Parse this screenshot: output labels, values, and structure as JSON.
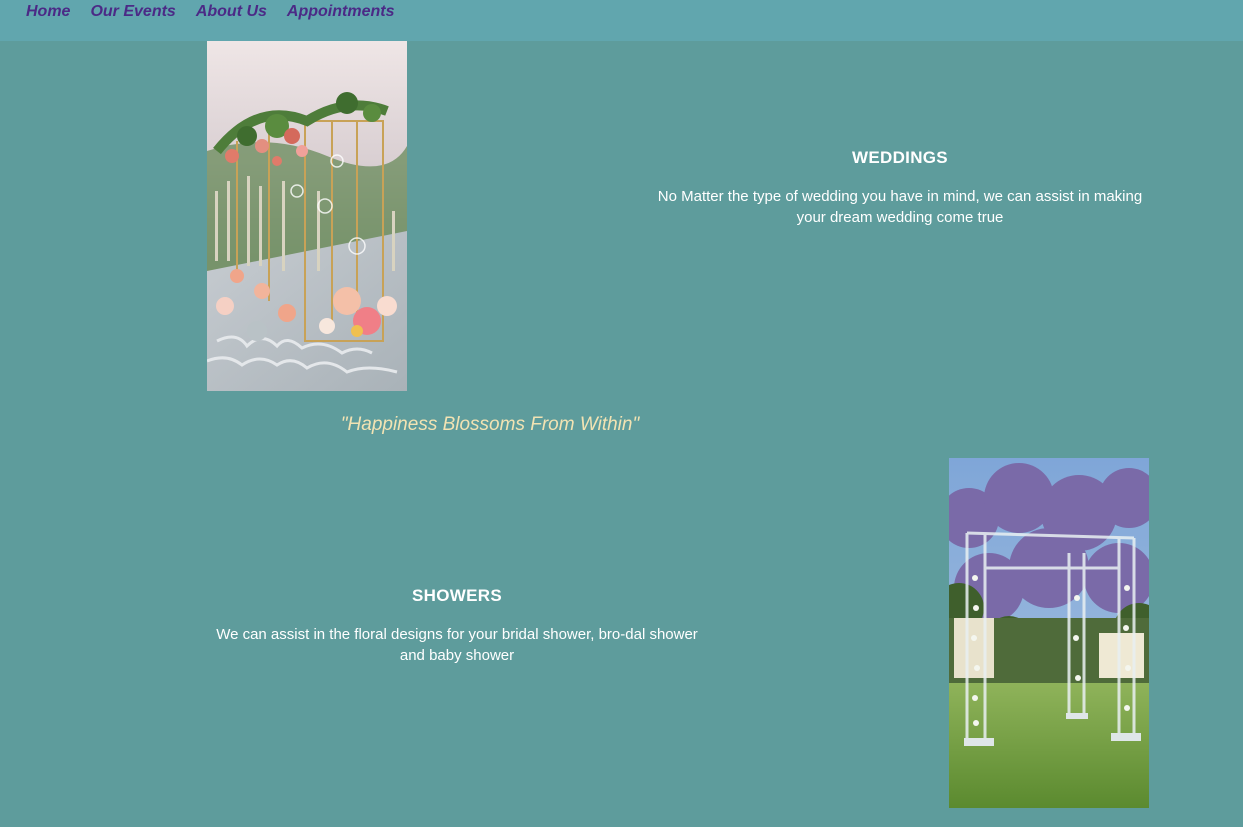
{
  "nav": {
    "items": [
      "Home",
      "Our Events",
      "About Us",
      "Appointments"
    ]
  },
  "weddings": {
    "title": "WEDDINGS",
    "description": "No Matter the type of wedding you have in mind, we can assist in making your dream wedding come true"
  },
  "tagline": "\"Happiness Blossoms From Within\"",
  "showers": {
    "title": "SHOWERS",
    "description": "We can assist in the floral designs for your bridal shower, bro-dal shower and baby shower"
  },
  "colors": {
    "background": "#5e9c9c",
    "navbar": "#61a6ae",
    "nav_link": "#4b2a86",
    "tagline": "#f2e3b3"
  }
}
